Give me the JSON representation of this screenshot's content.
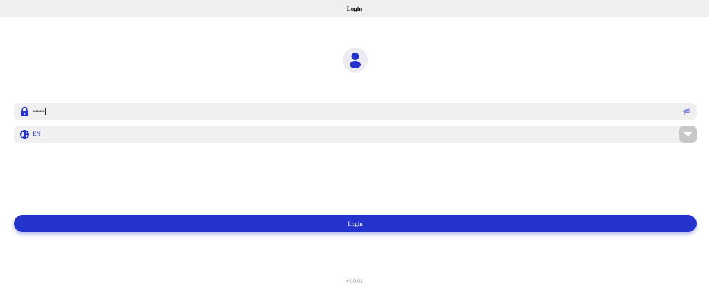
{
  "header": {
    "title": "Login"
  },
  "avatar": {
    "icon": "user-icon"
  },
  "password_field": {
    "icon": "lock-icon",
    "value": "••••••••",
    "toggle_icon": "eye-off-icon"
  },
  "language_select": {
    "icon": "globe-icon",
    "selected": "EN",
    "dropdown_icon": "triangle-down-icon"
  },
  "login_button": {
    "label": "Login"
  },
  "footer": {
    "version": "v1.0.01"
  },
  "colors": {
    "accent": "#2433cc",
    "field_background": "#f0f0f0",
    "header_background": "#efefef"
  }
}
